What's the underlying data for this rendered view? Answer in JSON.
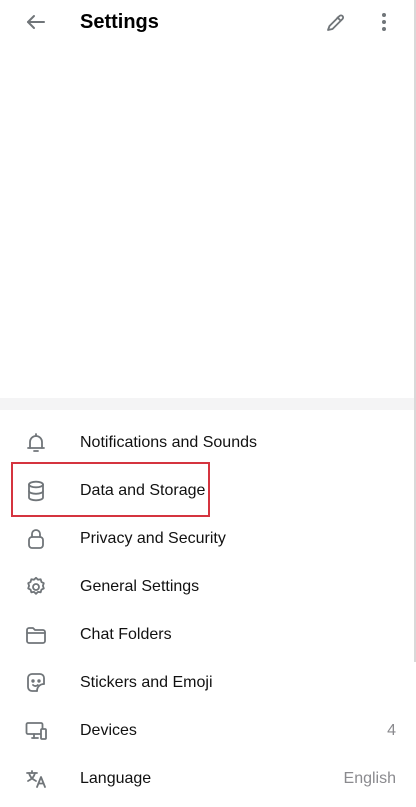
{
  "header": {
    "title": "Settings",
    "back_icon": "arrow-left-icon",
    "edit_icon": "pencil-icon",
    "more_icon": "more-vertical-icon"
  },
  "menu": {
    "items": [
      {
        "label": "Notifications and Sounds",
        "icon": "bell-icon",
        "value": ""
      },
      {
        "label": "Data and Storage",
        "icon": "database-icon",
        "value": ""
      },
      {
        "label": "Privacy and Security",
        "icon": "lock-icon",
        "value": ""
      },
      {
        "label": "General Settings",
        "icon": "gear-icon",
        "value": ""
      },
      {
        "label": "Chat Folders",
        "icon": "folder-icon",
        "value": ""
      },
      {
        "label": "Stickers and Emoji",
        "icon": "sticker-icon",
        "value": ""
      },
      {
        "label": "Devices",
        "icon": "devices-icon",
        "value": "4"
      },
      {
        "label": "Language",
        "icon": "translate-icon",
        "value": "English"
      }
    ]
  },
  "colors": {
    "icon": "#707579",
    "highlight": "#d5343f",
    "secondary_text": "#8a8a8e",
    "section_separator": "#f4f4f5"
  }
}
